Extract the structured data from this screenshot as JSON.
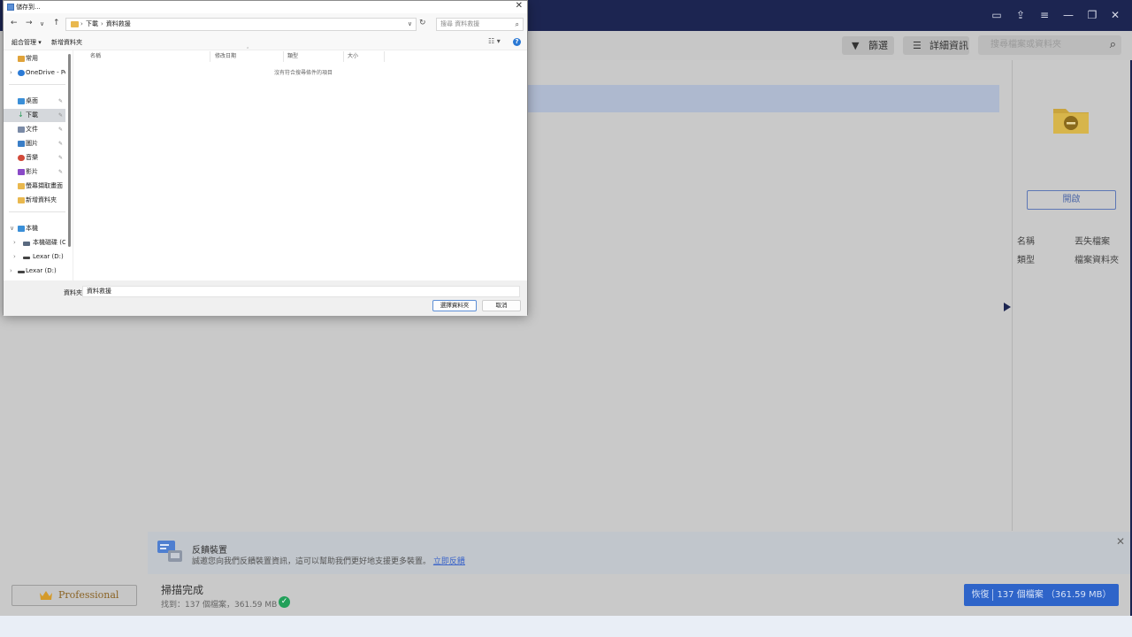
{
  "app": {
    "toolbar": {
      "filter_label": "篩選",
      "details_label": "詳細資訊",
      "search_placeholder": "搜尋檔案或資料夾"
    },
    "right_panel": {
      "open_label": "開啟",
      "props": [
        {
          "key": "名稱",
          "value": "丟失檔案"
        },
        {
          "key": "類型",
          "value": "檔案資料夾"
        }
      ]
    },
    "feedback": {
      "title": "反饋裝置",
      "text": "誠邀您向我們反饋裝置資訊，這可以幫助我們更好地支援更多裝置。",
      "link": "立即反饋"
    },
    "bottom": {
      "professional_label": "Professional",
      "scan_title": "掃描完成",
      "scan_detail": "找到：137 個檔案，361.59 MB",
      "recover_label": "恢復",
      "recover_detail": "137 個檔案 （361.59 MB）"
    },
    "colors": {
      "titlebar": "#1c2551",
      "accent": "#2e64c9",
      "success": "#22a05a"
    }
  },
  "dialog": {
    "title": "儲存到...",
    "address": {
      "root": "下載",
      "current": "資料救援"
    },
    "search_placeholder": "搜尋 資料救援",
    "commands": {
      "organize": "組合管理 ▾",
      "new_folder": "新增資料夾"
    },
    "nav_items": [
      {
        "label": "常用",
        "icon": "home-icon",
        "color": "#e0a33a"
      },
      {
        "label": "OneDrive - Per",
        "icon": "cloud-icon",
        "color": "#2c7bd6"
      },
      {
        "label": "桌面",
        "icon": "desktop-icon",
        "color": "#3a8fd8"
      },
      {
        "label": "下載",
        "icon": "download-icon",
        "color": "#2c9a5a"
      },
      {
        "label": "文件",
        "icon": "document-icon",
        "color": "#7a8aa6"
      },
      {
        "label": "圖片",
        "icon": "picture-icon",
        "color": "#3a7ec7"
      },
      {
        "label": "音樂",
        "icon": "music-icon",
        "color": "#d24a3a"
      },
      {
        "label": "影片",
        "icon": "video-icon",
        "color": "#8a4ac7"
      },
      {
        "label": "螢幕擷取畫面",
        "icon": "folder-icon",
        "color": "#e9b84e"
      },
      {
        "label": "新增資料夾",
        "icon": "folder-icon",
        "color": "#e9b84e"
      },
      {
        "label": "本機",
        "icon": "computer-icon",
        "color": "#3a8fd8"
      },
      {
        "label": "本機磁碟 (C:)",
        "icon": "drive-icon",
        "color": "#5a6a80"
      },
      {
        "label": "Lexar (D:)",
        "icon": "drive-icon",
        "color": "#444444"
      },
      {
        "label": "Lexar (D:)",
        "icon": "drive-icon",
        "color": "#444444"
      }
    ],
    "columns": [
      "名稱",
      "修改日期",
      "類型",
      "大小"
    ],
    "empty_message": "沒有符合搜尋條件的項目",
    "footer": {
      "folder_label": "資料夾:",
      "folder_value": "資料救援",
      "select_label": "選擇資料夾",
      "cancel_label": "取消"
    }
  }
}
